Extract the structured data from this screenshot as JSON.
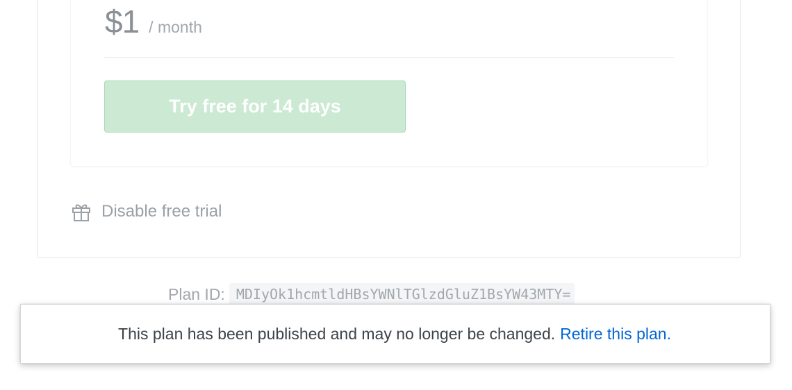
{
  "pricing": {
    "price": "$1",
    "period": "/ month",
    "trial_button_label": "Try free for 14 days"
  },
  "trial_toggle": {
    "icon": "gift-icon",
    "label": "Disable free trial"
  },
  "plan": {
    "id_label": "Plan ID:",
    "id_value": "MDIyOk1hcmtldHBsYWNlTGlzdGluZ1BsYW43MTY="
  },
  "notice": {
    "message": "This plan has been published and may no longer be changed.",
    "link_label": "Retire this plan."
  },
  "colors": {
    "trial_button_bg": "#cbe9d3",
    "link": "#0366d6",
    "muted_text": "#a2a7ad"
  }
}
